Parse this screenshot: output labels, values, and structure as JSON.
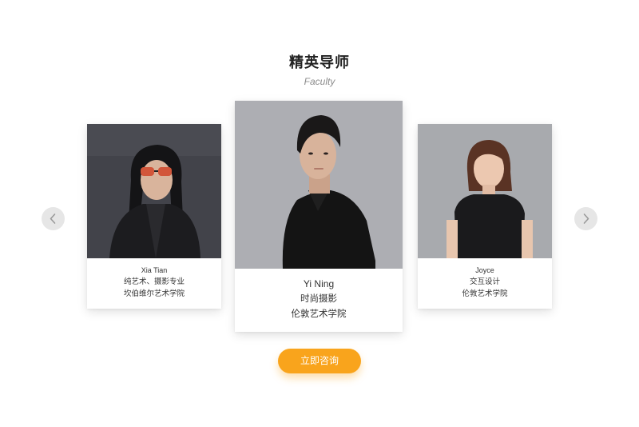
{
  "section": {
    "title": "精英导师",
    "subtitle": "Faculty"
  },
  "mentors": [
    {
      "name": "Xia Tian",
      "major": "纯艺术、摄影专业",
      "school": "坎伯维尔艺术学院"
    },
    {
      "name": "Yi Ning",
      "major": "时尚摄影",
      "school": "伦敦艺术学院"
    },
    {
      "name": "Joyce",
      "major": "交互设计",
      "school": "伦敦艺术学院"
    }
  ],
  "cta": {
    "label": "立即咨询"
  },
  "icons": {
    "prev": "chevron-left-icon",
    "next": "chevron-right-icon"
  },
  "colors": {
    "accent": "#f9a41c",
    "arrow_bg": "#e6e6e6",
    "title": "#222222",
    "subtitle": "#8c8c8c"
  }
}
